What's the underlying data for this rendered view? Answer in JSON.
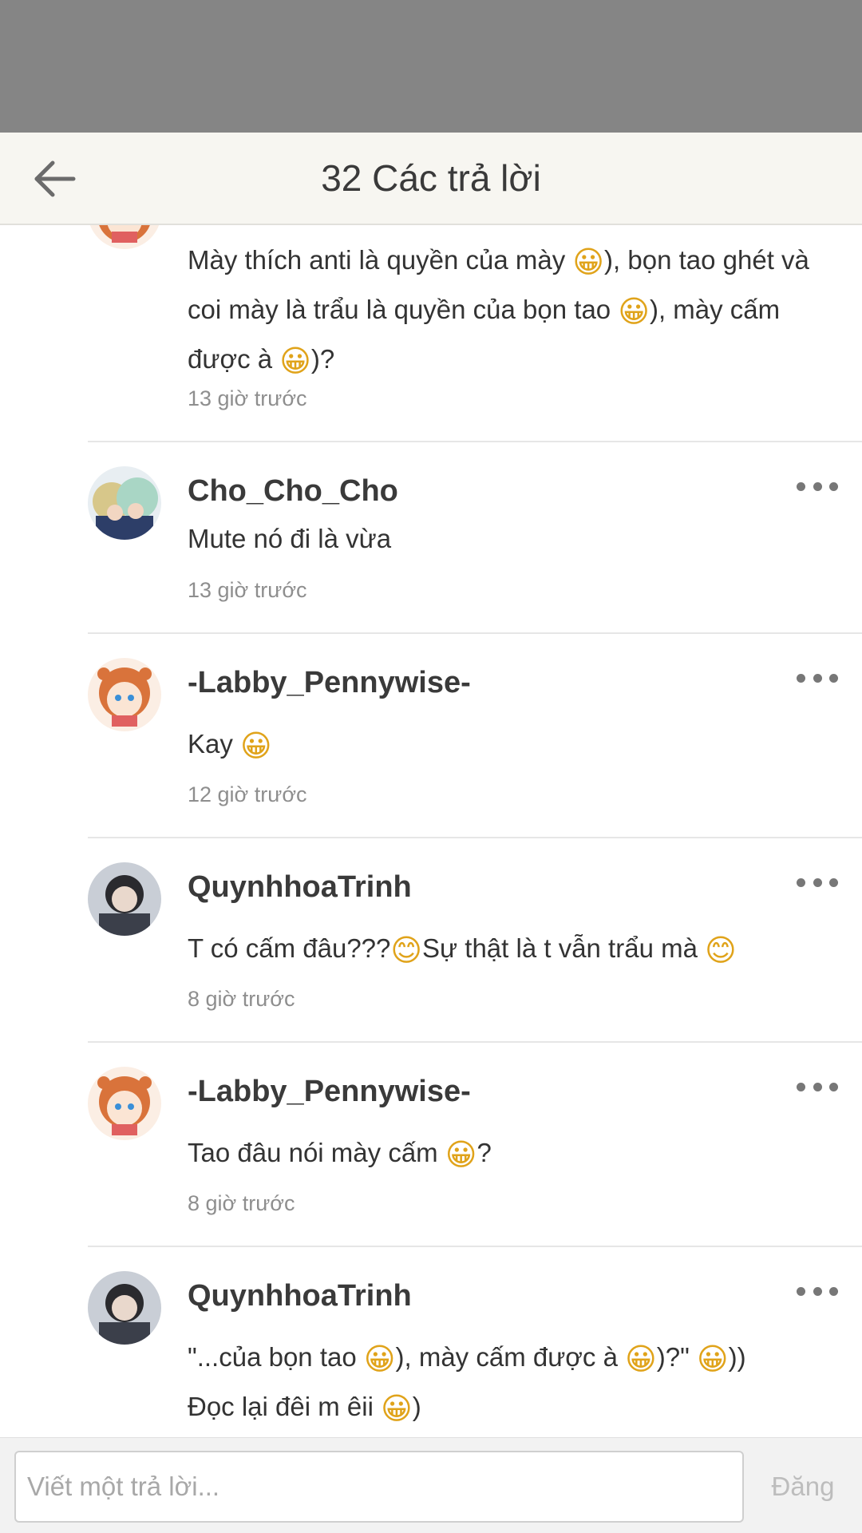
{
  "header": {
    "title": "32 Các trả lời",
    "back_icon": "arrow-left-icon"
  },
  "colors": {
    "status_bar": "#858585",
    "header_bg": "#f7f6f1",
    "text_primary": "#333333",
    "text_secondary": "#8e8e8e",
    "post_disabled": "#bdbdbd"
  },
  "comments": [
    {
      "text_parts": [
        "Mày thích anti là quyền của mày ",
        "😀",
        "), bọn tao ghét và coi mày là trẩu là quyền của bọn tao ",
        "😀",
        "), mày cấm được à ",
        "😀",
        ")?"
      ],
      "time": "13 giờ trước"
    },
    {
      "username": "Cho_Cho_Cho",
      "text_parts": [
        "Mute nó đi là vừa"
      ],
      "time": "13 giờ trước"
    },
    {
      "username": "-Labby_Pennywise-",
      "text_parts": [
        "Kay ",
        "😀"
      ],
      "time": "12 giờ trước"
    },
    {
      "username": "QuynhhoaTrinh",
      "text_parts": [
        "T có cấm đâu???",
        "😊",
        "Sự thật là t vẫn trẩu mà ",
        "😊"
      ],
      "time": "8 giờ trước"
    },
    {
      "username": "-Labby_Pennywise-",
      "text_parts": [
        "Tao đâu nói mày cấm ",
        "😀",
        "?"
      ],
      "time": "8 giờ trước"
    },
    {
      "username": "QuynhhoaTrinh",
      "text_parts": [
        "\"...của bọn tao ",
        "😀",
        "), mày cấm được à ",
        "😀",
        ")?\" ",
        "😀",
        "))",
        "Đọc lại đêi m êii ",
        "😀",
        ")"
      ]
    }
  ],
  "footer": {
    "input_placeholder": "Viết một trả lời...",
    "post_label": "Đăng"
  }
}
